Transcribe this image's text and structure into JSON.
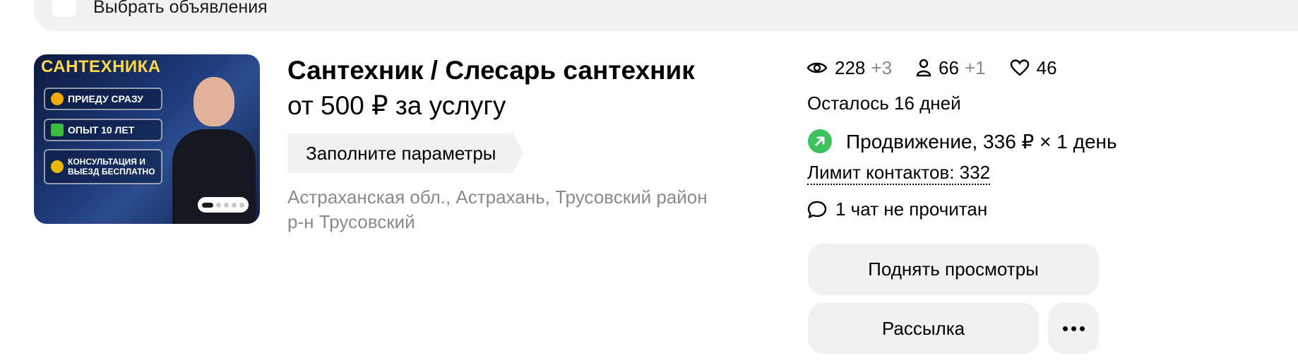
{
  "header": {
    "select_label": "Выбрать объявления"
  },
  "listing": {
    "photo": {
      "title": "САНТЕХНИКА",
      "chips": [
        {
          "icon": "location-pin-icon",
          "label": "ПРИЕДУ СРАЗУ"
        },
        {
          "icon": "checkmark-icon",
          "label": "ОПЫТ 10 ЛЕТ"
        },
        {
          "icon": "medal-icon",
          "label": "КОНСУЛЬТАЦИЯ И ВЫЕЗД БЕСПЛАТНО"
        }
      ],
      "carousel_total": 5,
      "carousel_active": 1
    },
    "title": "Сантехник / Слесарь сантехник",
    "price": "от 500 ₽ за услугу",
    "param_tag": "Заполните параметры",
    "address_line1": "Астраханская обл., Астрахань, Трусовский район",
    "address_line2": "р-н Трусовский"
  },
  "stats": {
    "views": "228",
    "views_delta": "+3",
    "contacts": "66",
    "contacts_delta": "+1",
    "favorites": "46"
  },
  "status": {
    "remaining": "Осталось 16 дней",
    "promotion": "Продвижение, 336 ₽ × 1 день",
    "contact_limit": "Лимит контактов: 332",
    "chat": "1 чат не прочитан"
  },
  "actions": {
    "raise_views": "Поднять просмотры",
    "mailing": "Рассылка",
    "more_icon": "more-dots-icon"
  },
  "colors": {
    "panel_bg": "#f2f1f0",
    "muted_text": "#8a8a8a",
    "promo_green": "#3cc25e",
    "photo_accent": "#ffd84a"
  }
}
